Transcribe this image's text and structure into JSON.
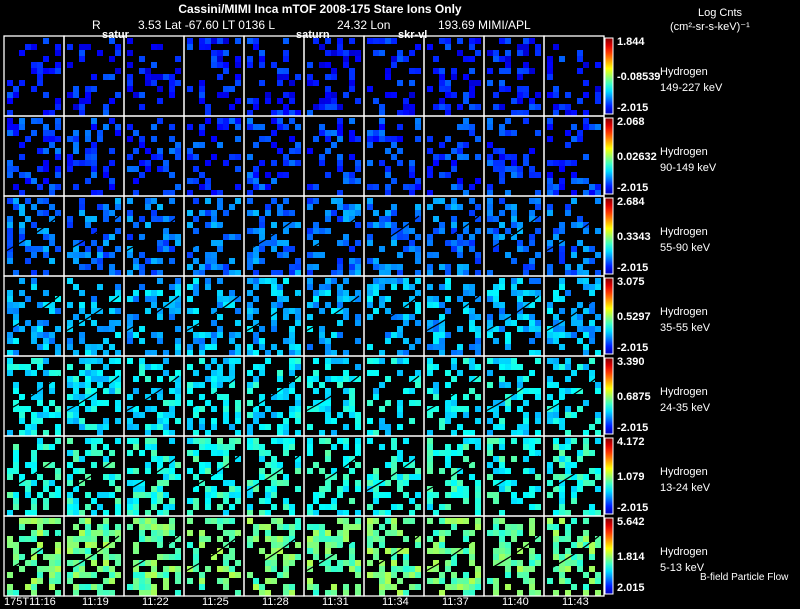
{
  "header": {
    "title": "Cassini/MIMI Inca mTOF  2008-175   Stare   Ions Only",
    "r_label": "R",
    "position": "3.53 Lat -67.60 LT 0136 L",
    "lon": "24.32 Lon",
    "lon_val": "193.69  MIMI/APL",
    "col_labels": [
      "satur",
      "saturn",
      "skr-vl"
    ]
  },
  "units": {
    "line1": "Log Cnts",
    "line2": "(cm²-sr-s-keV)⁻¹"
  },
  "footer_label": "B-field Particle Flow",
  "chart_data": {
    "type": "heatmap",
    "title": "Cassini/MIMI Inca mTOF  2008-175   Stare   Ions Only",
    "time_labels": [
      "175T11:16",
      "11:19",
      "11:22",
      "11:25",
      "11:28",
      "11:31",
      "11:34",
      "11:37",
      "11:40",
      "11:43"
    ],
    "rows": [
      {
        "species": "Hydrogen",
        "energy": "149-227 keV",
        "max": "1.844",
        "mid": "-0.08539",
        "min": "-2.015",
        "level": 0.15
      },
      {
        "species": "Hydrogen",
        "energy": "90-149 keV",
        "max": "2.068",
        "mid": "0.02632",
        "min": "-2.015",
        "level": 0.18
      },
      {
        "species": "Hydrogen",
        "energy": "55-90 keV",
        "max": "2.684",
        "mid": "0.3343",
        "min": "-2.015",
        "level": 0.24
      },
      {
        "species": "Hydrogen",
        "energy": "35-55 keV",
        "max": "3.075",
        "mid": "0.5297",
        "min": "-2.015",
        "level": 0.3
      },
      {
        "species": "Hydrogen",
        "energy": "24-35 keV",
        "max": "3.390",
        "mid": "0.6875",
        "min": "-2.015",
        "level": 0.36
      },
      {
        "species": "Hydrogen",
        "energy": "13-24 keV",
        "max": "4.172",
        "mid": "1.079",
        "min": "-2.015",
        "level": 0.4
      },
      {
        "species": "Hydrogen",
        "energy": "5-13 keV",
        "max": "5.642",
        "mid": "1.814",
        "min": "2.015",
        "level": 0.48
      }
    ]
  }
}
